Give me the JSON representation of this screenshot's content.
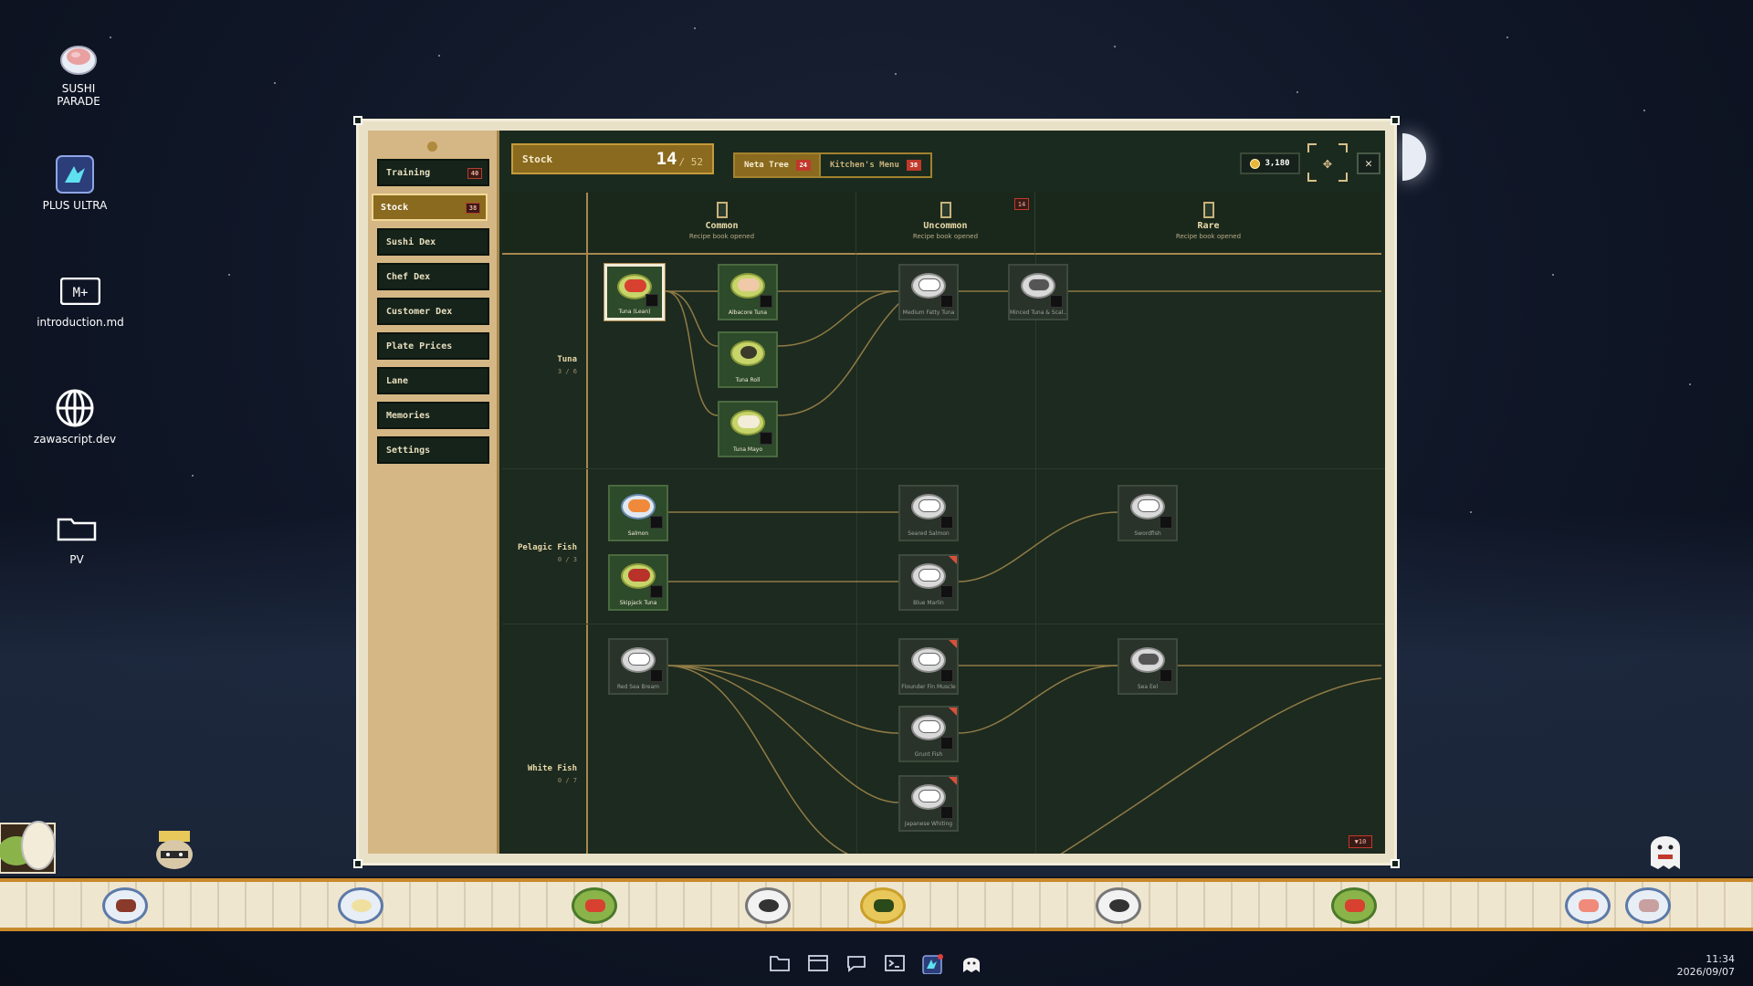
{
  "desktop": {
    "icons": [
      {
        "label": "SUSHI\nPARADE",
        "icon": "sushi-icon"
      },
      {
        "label": "PLUS ULTRA",
        "icon": "bird-app-icon"
      },
      {
        "label": "introduction.md",
        "icon": "markdown-icon"
      },
      {
        "label": "zawascript.dev",
        "icon": "globe-icon"
      },
      {
        "label": "PV",
        "icon": "folder-icon"
      }
    ]
  },
  "sidebar": {
    "items": [
      {
        "label": "Training",
        "badge": "40"
      },
      {
        "label": "Stock",
        "badge": "38",
        "active": true
      },
      {
        "label": "Sushi Dex"
      },
      {
        "label": "Chef Dex"
      },
      {
        "label": "Customer Dex"
      },
      {
        "label": "Plate Prices"
      },
      {
        "label": "Lane"
      },
      {
        "label": "Memories"
      },
      {
        "label": "Settings"
      }
    ]
  },
  "topbar": {
    "stock_label": "Stock",
    "stock_count": "14",
    "stock_total": "/ 52",
    "tabs": [
      {
        "label": "Neta Tree",
        "badge": "24",
        "active": true
      },
      {
        "label": "Kitchen's Menu",
        "badge": "38",
        "active": false
      }
    ],
    "coins": "3,180",
    "close_glyph": "✕",
    "focus_glyph": "✥"
  },
  "rarities": [
    {
      "name": "Common",
      "sub": "Recipe book opened"
    },
    {
      "name": "Uncommon",
      "sub": "Recipe book opened",
      "badge": "14"
    },
    {
      "name": "Rare",
      "sub": "Recipe book opened"
    }
  ],
  "categories": [
    {
      "name": "Tuna",
      "count": "3 / 6"
    },
    {
      "name": "Pelagic Fish",
      "count": "0 / 3"
    },
    {
      "name": "White Fish",
      "count": "0 / 7"
    }
  ],
  "cards": [
    {
      "label": "Tuna (Lean)",
      "state": "selected",
      "neta": "#d8412f"
    },
    {
      "label": "Albacore Tuna",
      "state": "owned",
      "neta": "#f0c9a8"
    },
    {
      "label": "Tuna Roll",
      "state": "owned",
      "neta": "#3a3a2a"
    },
    {
      "label": "Tuna Mayo",
      "state": "owned",
      "neta": "#f2ecd8"
    },
    {
      "label": "Medium Fatty Tuna",
      "state": "locked"
    },
    {
      "label": "Minced Tuna & Scal...",
      "state": "locked"
    },
    {
      "label": "Salmon",
      "state": "owned",
      "neta": "#f08a3a"
    },
    {
      "label": "Skipjack Tuna",
      "state": "owned",
      "neta": "#b8322a"
    },
    {
      "label": "Seared Salmon",
      "state": "locked"
    },
    {
      "label": "Blue Marlin",
      "state": "locked",
      "new": true
    },
    {
      "label": "Swordfish",
      "state": "locked"
    },
    {
      "label": "Red Sea Bream",
      "state": "locked"
    },
    {
      "label": "Flounder Fin Muscle",
      "state": "locked",
      "new": true
    },
    {
      "label": "Grunt Fish",
      "state": "locked",
      "new": true
    },
    {
      "label": "Japanese Whiting",
      "state": "locked",
      "new": true
    },
    {
      "label": "Sea Eel",
      "state": "locked"
    }
  ],
  "scroll_badge": "▼10",
  "taskbar": {
    "icons": [
      "folder-icon",
      "window-icon",
      "chat-icon",
      "terminal-icon",
      "bird-app-icon",
      "ghost-icon"
    ],
    "time": "11:34",
    "date": "2026/09/07"
  },
  "colors": {
    "accent_gold": "#8a6a1e",
    "panel_dark": "#1d2a1f",
    "sidebar_tan": "#d4b784",
    "badge_red": "#c0392b"
  }
}
